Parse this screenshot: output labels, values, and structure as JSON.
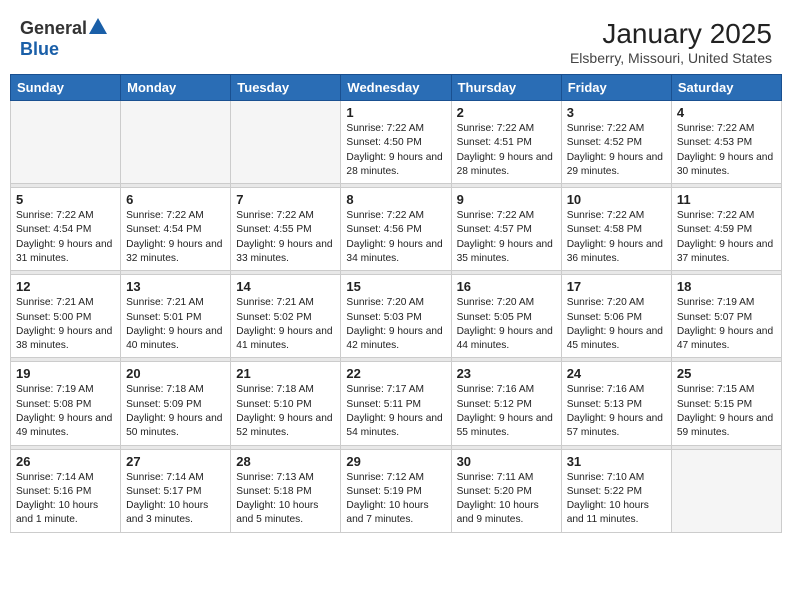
{
  "header": {
    "logo_general": "General",
    "logo_blue": "Blue",
    "title": "January 2025",
    "subtitle": "Elsberry, Missouri, United States"
  },
  "weekdays": [
    "Sunday",
    "Monday",
    "Tuesday",
    "Wednesday",
    "Thursday",
    "Friday",
    "Saturday"
  ],
  "weeks": [
    [
      {
        "day": "",
        "empty": true
      },
      {
        "day": "",
        "empty": true
      },
      {
        "day": "",
        "empty": true
      },
      {
        "day": "1",
        "sunrise": "7:22 AM",
        "sunset": "4:50 PM",
        "daylight": "9 hours and 28 minutes."
      },
      {
        "day": "2",
        "sunrise": "7:22 AM",
        "sunset": "4:51 PM",
        "daylight": "9 hours and 28 minutes."
      },
      {
        "day": "3",
        "sunrise": "7:22 AM",
        "sunset": "4:52 PM",
        "daylight": "9 hours and 29 minutes."
      },
      {
        "day": "4",
        "sunrise": "7:22 AM",
        "sunset": "4:53 PM",
        "daylight": "9 hours and 30 minutes."
      }
    ],
    [
      {
        "day": "5",
        "sunrise": "7:22 AM",
        "sunset": "4:54 PM",
        "daylight": "9 hours and 31 minutes."
      },
      {
        "day": "6",
        "sunrise": "7:22 AM",
        "sunset": "4:54 PM",
        "daylight": "9 hours and 32 minutes."
      },
      {
        "day": "7",
        "sunrise": "7:22 AM",
        "sunset": "4:55 PM",
        "daylight": "9 hours and 33 minutes."
      },
      {
        "day": "8",
        "sunrise": "7:22 AM",
        "sunset": "4:56 PM",
        "daylight": "9 hours and 34 minutes."
      },
      {
        "day": "9",
        "sunrise": "7:22 AM",
        "sunset": "4:57 PM",
        "daylight": "9 hours and 35 minutes."
      },
      {
        "day": "10",
        "sunrise": "7:22 AM",
        "sunset": "4:58 PM",
        "daylight": "9 hours and 36 minutes."
      },
      {
        "day": "11",
        "sunrise": "7:22 AM",
        "sunset": "4:59 PM",
        "daylight": "9 hours and 37 minutes."
      }
    ],
    [
      {
        "day": "12",
        "sunrise": "7:21 AM",
        "sunset": "5:00 PM",
        "daylight": "9 hours and 38 minutes."
      },
      {
        "day": "13",
        "sunrise": "7:21 AM",
        "sunset": "5:01 PM",
        "daylight": "9 hours and 40 minutes."
      },
      {
        "day": "14",
        "sunrise": "7:21 AM",
        "sunset": "5:02 PM",
        "daylight": "9 hours and 41 minutes."
      },
      {
        "day": "15",
        "sunrise": "7:20 AM",
        "sunset": "5:03 PM",
        "daylight": "9 hours and 42 minutes."
      },
      {
        "day": "16",
        "sunrise": "7:20 AM",
        "sunset": "5:05 PM",
        "daylight": "9 hours and 44 minutes."
      },
      {
        "day": "17",
        "sunrise": "7:20 AM",
        "sunset": "5:06 PM",
        "daylight": "9 hours and 45 minutes."
      },
      {
        "day": "18",
        "sunrise": "7:19 AM",
        "sunset": "5:07 PM",
        "daylight": "9 hours and 47 minutes."
      }
    ],
    [
      {
        "day": "19",
        "sunrise": "7:19 AM",
        "sunset": "5:08 PM",
        "daylight": "9 hours and 49 minutes."
      },
      {
        "day": "20",
        "sunrise": "7:18 AM",
        "sunset": "5:09 PM",
        "daylight": "9 hours and 50 minutes."
      },
      {
        "day": "21",
        "sunrise": "7:18 AM",
        "sunset": "5:10 PM",
        "daylight": "9 hours and 52 minutes."
      },
      {
        "day": "22",
        "sunrise": "7:17 AM",
        "sunset": "5:11 PM",
        "daylight": "9 hours and 54 minutes."
      },
      {
        "day": "23",
        "sunrise": "7:16 AM",
        "sunset": "5:12 PM",
        "daylight": "9 hours and 55 minutes."
      },
      {
        "day": "24",
        "sunrise": "7:16 AM",
        "sunset": "5:13 PM",
        "daylight": "9 hours and 57 minutes."
      },
      {
        "day": "25",
        "sunrise": "7:15 AM",
        "sunset": "5:15 PM",
        "daylight": "9 hours and 59 minutes."
      }
    ],
    [
      {
        "day": "26",
        "sunrise": "7:14 AM",
        "sunset": "5:16 PM",
        "daylight": "10 hours and 1 minute."
      },
      {
        "day": "27",
        "sunrise": "7:14 AM",
        "sunset": "5:17 PM",
        "daylight": "10 hours and 3 minutes."
      },
      {
        "day": "28",
        "sunrise": "7:13 AM",
        "sunset": "5:18 PM",
        "daylight": "10 hours and 5 minutes."
      },
      {
        "day": "29",
        "sunrise": "7:12 AM",
        "sunset": "5:19 PM",
        "daylight": "10 hours and 7 minutes."
      },
      {
        "day": "30",
        "sunrise": "7:11 AM",
        "sunset": "5:20 PM",
        "daylight": "10 hours and 9 minutes."
      },
      {
        "day": "31",
        "sunrise": "7:10 AM",
        "sunset": "5:22 PM",
        "daylight": "10 hours and 11 minutes."
      },
      {
        "day": "",
        "empty": true
      }
    ]
  ],
  "labels": {
    "sunrise": "Sunrise:",
    "sunset": "Sunset:",
    "daylight": "Daylight:"
  }
}
